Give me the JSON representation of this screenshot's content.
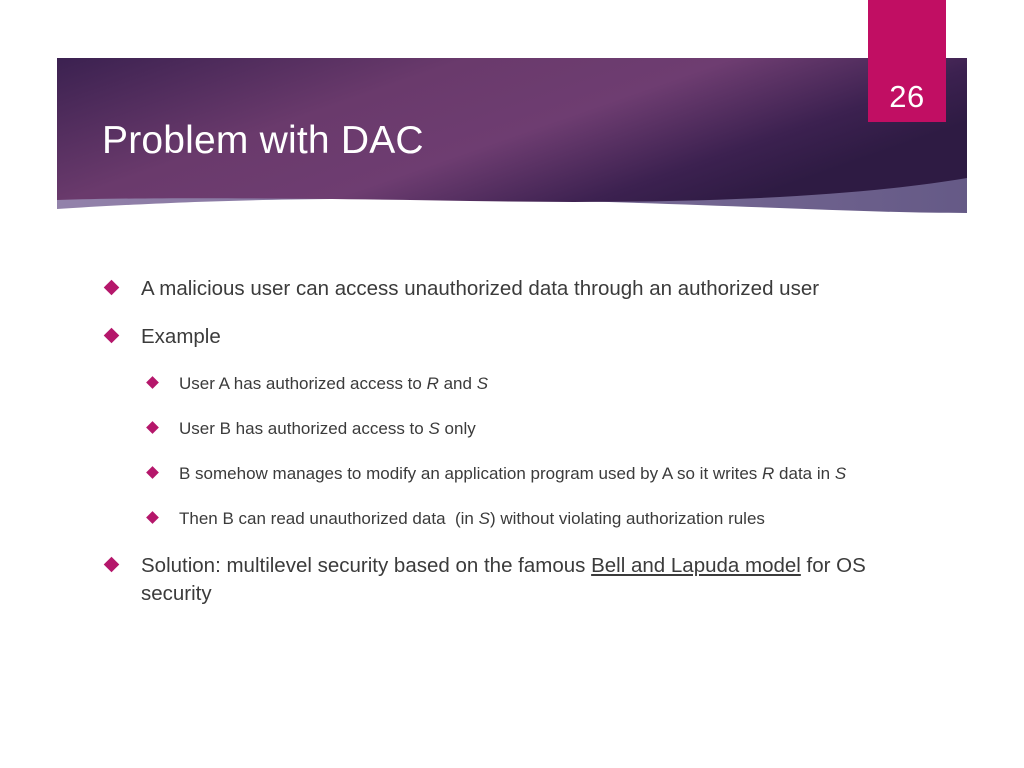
{
  "slide": {
    "number": "26",
    "title": "Problem with DAC",
    "colors": {
      "banner_dark_purple": "#3b2150",
      "banner_mid_purple": "#6b3a6e",
      "banner_light_swoosh": "#6d5f8c",
      "slide_number_pink": "#c10e63",
      "bullet_magenta": "#b5176b",
      "body_text": "#3b3b3b",
      "background": "#ffffff"
    }
  },
  "bullets": [
    {
      "level": 1,
      "text": "A malicious user can access unauthorized data through an authorized user",
      "parts": [
        {
          "t": "A malicious user can access unauthorized data through an authorized user",
          "style": "normal"
        }
      ]
    },
    {
      "level": 1,
      "text": "Example",
      "parts": [
        {
          "t": "Example",
          "style": "normal"
        }
      ]
    },
    {
      "level": 2,
      "text": "User A has authorized access to R and S",
      "parts": [
        {
          "t": "User A has authorized access to ",
          "style": "normal"
        },
        {
          "t": "R",
          "style": "italic"
        },
        {
          "t": " and ",
          "style": "normal"
        },
        {
          "t": "S",
          "style": "italic"
        }
      ]
    },
    {
      "level": 2,
      "text": "User B has authorized access to S only",
      "parts": [
        {
          "t": "User B has authorized access to ",
          "style": "normal"
        },
        {
          "t": "S",
          "style": "italic"
        },
        {
          "t": " only",
          "style": "normal"
        }
      ]
    },
    {
      "level": 2,
      "text": "B somehow manages to modify an application program used by A so it writes R data in S",
      "parts": [
        {
          "t": "B somehow manages to modify an application program used by A so it writes ",
          "style": "normal"
        },
        {
          "t": "R",
          "style": "italic"
        },
        {
          "t": " data in ",
          "style": "normal"
        },
        {
          "t": "S",
          "style": "italic"
        }
      ]
    },
    {
      "level": 2,
      "text": "Then B can read unauthorized data  (in S) without violating authorization rules",
      "parts": [
        {
          "t": "Then B can read unauthorized data  (in ",
          "style": "normal"
        },
        {
          "t": "S",
          "style": "italic"
        },
        {
          "t": ") without violating authorization rules",
          "style": "normal"
        }
      ]
    },
    {
      "level": 1,
      "text": "Solution: multilevel security based on the famous Bell and Lapuda model for OS security",
      "parts": [
        {
          "t": "Solution: multilevel security based on the famous ",
          "style": "normal"
        },
        {
          "t": "Bell and Lapuda model",
          "style": "underline"
        },
        {
          "t": " for OS security",
          "style": "normal"
        }
      ]
    }
  ]
}
